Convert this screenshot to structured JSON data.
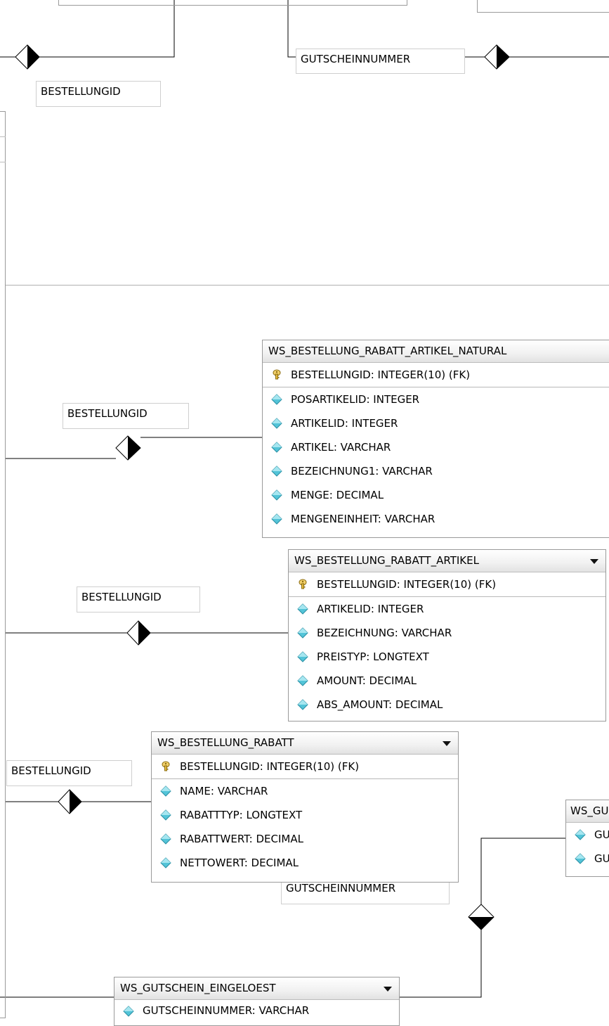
{
  "tables": {
    "natural": {
      "name": "WS_BESTELLUNG_RABATT_ARTIKEL_NATURAL",
      "pk": "BESTELLUNGID: INTEGER(10) (FK)",
      "columns": [
        "POSARTIKELID: INTEGER",
        "ARTIKELID: INTEGER",
        "ARTIKEL: VARCHAR",
        "BEZEICHNUNG1: VARCHAR",
        "MENGE: DECIMAL",
        "MENGENEINHEIT: VARCHAR"
      ]
    },
    "rabatt_artikel": {
      "name": "WS_BESTELLUNG_RABATT_ARTIKEL",
      "pk": "BESTELLUNGID: INTEGER(10) (FK)",
      "columns": [
        "ARTIKELID: INTEGER",
        "BEZEICHNUNG: VARCHAR",
        "PREISTYP: LONGTEXT",
        "AMOUNT: DECIMAL",
        "ABS_AMOUNT: DECIMAL"
      ]
    },
    "rabatt": {
      "name": "WS_BESTELLUNG_RABATT",
      "pk": "BESTELLUNGID: INTEGER(10) (FK)",
      "columns": [
        "NAME: VARCHAR",
        "RABATTTYP: LONGTEXT",
        "RABATTWERT: DECIMAL",
        "NETTOWERT: DECIMAL"
      ]
    },
    "gutschein_partial": {
      "name": "WS_GU",
      "columns": [
        "GU",
        "GU"
      ]
    },
    "eingeloest": {
      "name": "WS_GUTSCHEIN_EINGELOEST",
      "columns": [
        "GUTSCHEINNUMMER: VARCHAR"
      ]
    }
  },
  "labels": {
    "top_bestellungid": "BESTELLUNGID",
    "top_gutscheinnummer": "GUTSCHEINNUMMER",
    "natural_bestellungid": "BESTELLUNGID",
    "artikel_bestellungid": "BESTELLUNGID",
    "rabatt_bestellungid": "BESTELLUNGID",
    "bottom_gutscheinnummer": "GUTSCHEINNUMMER"
  },
  "icons": {
    "primary_key": "key-icon",
    "column": "diamond-column-icon",
    "relationship": "diamond-relationship-icon",
    "dropdown": "chevron-down-icon"
  }
}
